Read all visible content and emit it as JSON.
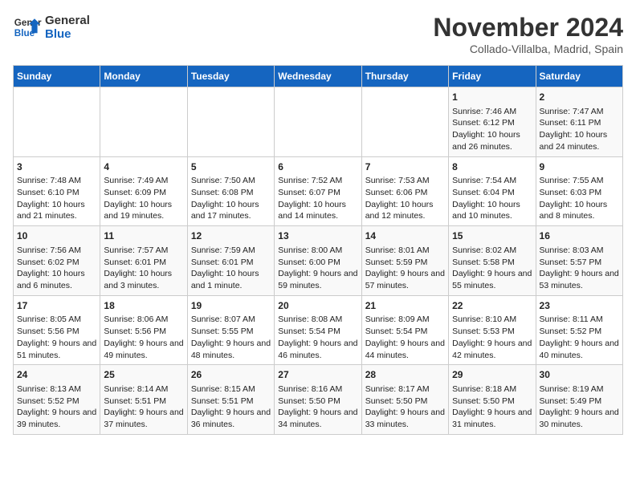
{
  "header": {
    "logo_general": "General",
    "logo_blue": "Blue",
    "month": "November 2024",
    "location": "Collado-Villalba, Madrid, Spain"
  },
  "days_of_week": [
    "Sunday",
    "Monday",
    "Tuesday",
    "Wednesday",
    "Thursday",
    "Friday",
    "Saturday"
  ],
  "weeks": [
    [
      {
        "day": "",
        "info": ""
      },
      {
        "day": "",
        "info": ""
      },
      {
        "day": "",
        "info": ""
      },
      {
        "day": "",
        "info": ""
      },
      {
        "day": "",
        "info": ""
      },
      {
        "day": "1",
        "info": "Sunrise: 7:46 AM\nSunset: 6:12 PM\nDaylight: 10 hours and 26 minutes."
      },
      {
        "day": "2",
        "info": "Sunrise: 7:47 AM\nSunset: 6:11 PM\nDaylight: 10 hours and 24 minutes."
      }
    ],
    [
      {
        "day": "3",
        "info": "Sunrise: 7:48 AM\nSunset: 6:10 PM\nDaylight: 10 hours and 21 minutes."
      },
      {
        "day": "4",
        "info": "Sunrise: 7:49 AM\nSunset: 6:09 PM\nDaylight: 10 hours and 19 minutes."
      },
      {
        "day": "5",
        "info": "Sunrise: 7:50 AM\nSunset: 6:08 PM\nDaylight: 10 hours and 17 minutes."
      },
      {
        "day": "6",
        "info": "Sunrise: 7:52 AM\nSunset: 6:07 PM\nDaylight: 10 hours and 14 minutes."
      },
      {
        "day": "7",
        "info": "Sunrise: 7:53 AM\nSunset: 6:06 PM\nDaylight: 10 hours and 12 minutes."
      },
      {
        "day": "8",
        "info": "Sunrise: 7:54 AM\nSunset: 6:04 PM\nDaylight: 10 hours and 10 minutes."
      },
      {
        "day": "9",
        "info": "Sunrise: 7:55 AM\nSunset: 6:03 PM\nDaylight: 10 hours and 8 minutes."
      }
    ],
    [
      {
        "day": "10",
        "info": "Sunrise: 7:56 AM\nSunset: 6:02 PM\nDaylight: 10 hours and 6 minutes."
      },
      {
        "day": "11",
        "info": "Sunrise: 7:57 AM\nSunset: 6:01 PM\nDaylight: 10 hours and 3 minutes."
      },
      {
        "day": "12",
        "info": "Sunrise: 7:59 AM\nSunset: 6:01 PM\nDaylight: 10 hours and 1 minute."
      },
      {
        "day": "13",
        "info": "Sunrise: 8:00 AM\nSunset: 6:00 PM\nDaylight: 9 hours and 59 minutes."
      },
      {
        "day": "14",
        "info": "Sunrise: 8:01 AM\nSunset: 5:59 PM\nDaylight: 9 hours and 57 minutes."
      },
      {
        "day": "15",
        "info": "Sunrise: 8:02 AM\nSunset: 5:58 PM\nDaylight: 9 hours and 55 minutes."
      },
      {
        "day": "16",
        "info": "Sunrise: 8:03 AM\nSunset: 5:57 PM\nDaylight: 9 hours and 53 minutes."
      }
    ],
    [
      {
        "day": "17",
        "info": "Sunrise: 8:05 AM\nSunset: 5:56 PM\nDaylight: 9 hours and 51 minutes."
      },
      {
        "day": "18",
        "info": "Sunrise: 8:06 AM\nSunset: 5:56 PM\nDaylight: 9 hours and 49 minutes."
      },
      {
        "day": "19",
        "info": "Sunrise: 8:07 AM\nSunset: 5:55 PM\nDaylight: 9 hours and 48 minutes."
      },
      {
        "day": "20",
        "info": "Sunrise: 8:08 AM\nSunset: 5:54 PM\nDaylight: 9 hours and 46 minutes."
      },
      {
        "day": "21",
        "info": "Sunrise: 8:09 AM\nSunset: 5:54 PM\nDaylight: 9 hours and 44 minutes."
      },
      {
        "day": "22",
        "info": "Sunrise: 8:10 AM\nSunset: 5:53 PM\nDaylight: 9 hours and 42 minutes."
      },
      {
        "day": "23",
        "info": "Sunrise: 8:11 AM\nSunset: 5:52 PM\nDaylight: 9 hours and 40 minutes."
      }
    ],
    [
      {
        "day": "24",
        "info": "Sunrise: 8:13 AM\nSunset: 5:52 PM\nDaylight: 9 hours and 39 minutes."
      },
      {
        "day": "25",
        "info": "Sunrise: 8:14 AM\nSunset: 5:51 PM\nDaylight: 9 hours and 37 minutes."
      },
      {
        "day": "26",
        "info": "Sunrise: 8:15 AM\nSunset: 5:51 PM\nDaylight: 9 hours and 36 minutes."
      },
      {
        "day": "27",
        "info": "Sunrise: 8:16 AM\nSunset: 5:50 PM\nDaylight: 9 hours and 34 minutes."
      },
      {
        "day": "28",
        "info": "Sunrise: 8:17 AM\nSunset: 5:50 PM\nDaylight: 9 hours and 33 minutes."
      },
      {
        "day": "29",
        "info": "Sunrise: 8:18 AM\nSunset: 5:50 PM\nDaylight: 9 hours and 31 minutes."
      },
      {
        "day": "30",
        "info": "Sunrise: 8:19 AM\nSunset: 5:49 PM\nDaylight: 9 hours and 30 minutes."
      }
    ]
  ]
}
